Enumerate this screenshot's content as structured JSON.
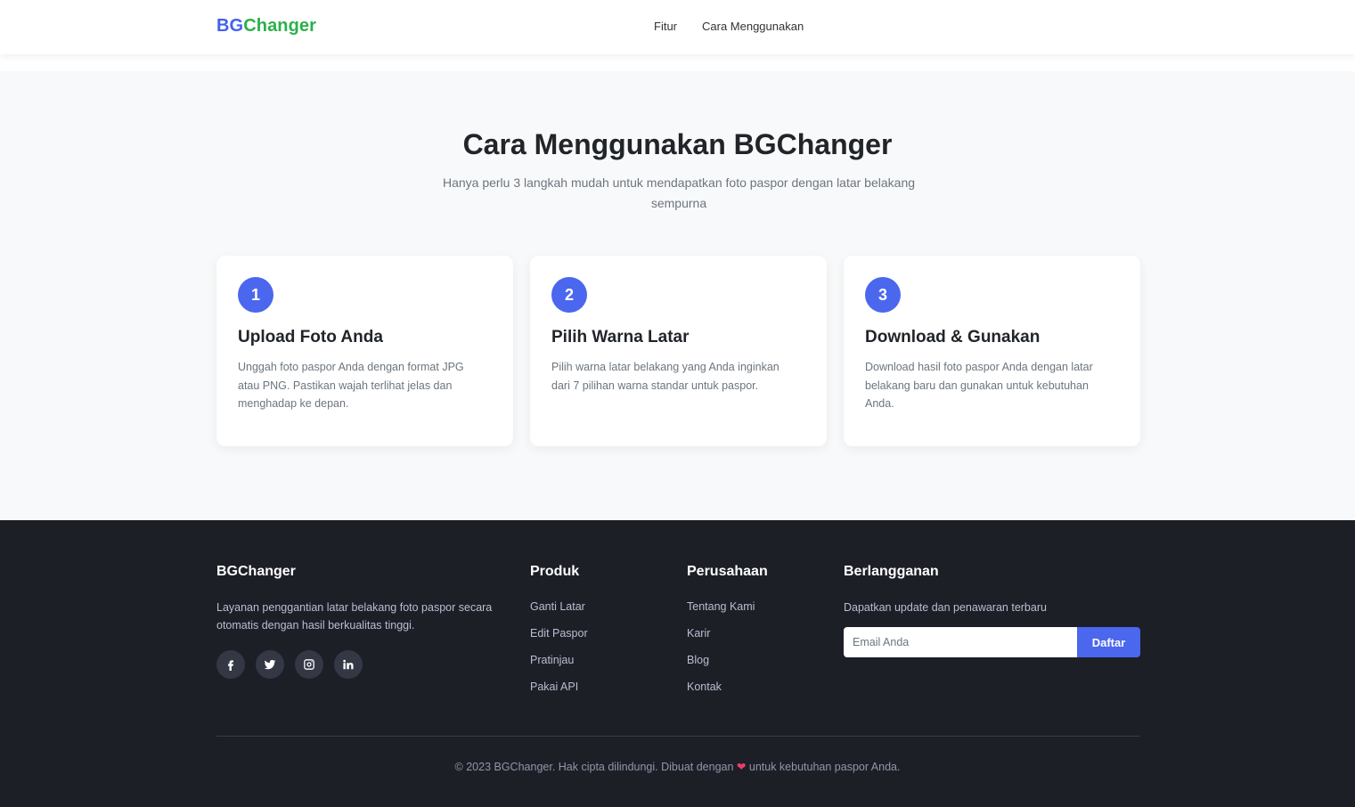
{
  "nav": {
    "logo_part1": "BG",
    "logo_part2": "Changer",
    "links": [
      "Fitur",
      "Cara Menggunakan"
    ]
  },
  "howto": {
    "title": "Cara Menggunakan BGChanger",
    "subtitle": "Hanya perlu 3 langkah mudah untuk mendapatkan foto paspor dengan latar belakang sempurna",
    "steps": [
      {
        "number": "1",
        "title": "Upload Foto Anda",
        "desc": "Unggah foto paspor Anda dengan format JPG atau PNG. Pastikan wajah terlihat jelas dan menghadap ke depan."
      },
      {
        "number": "2",
        "title": "Pilih Warna Latar",
        "desc": "Pilih warna latar belakang yang Anda inginkan dari 7 pilihan warna standar untuk paspor."
      },
      {
        "number": "3",
        "title": "Download & Gunakan",
        "desc": "Download hasil foto paspor Anda dengan latar belakang baru dan gunakan untuk kebutuhan Anda."
      }
    ]
  },
  "footer": {
    "brand": {
      "title": "BGChanger",
      "desc": "Layanan penggantian latar belakang foto paspor secara otomatis dengan hasil berkualitas tinggi.",
      "socials": [
        "facebook-icon",
        "twitter-icon",
        "instagram-icon",
        "linkedin-icon"
      ]
    },
    "produk": {
      "title": "Produk",
      "links": [
        "Ganti Latar",
        "Edit Paspor",
        "Pratinjau",
        "Pakai API"
      ]
    },
    "perusahaan": {
      "title": "Perusahaan",
      "links": [
        "Tentang Kami",
        "Karir",
        "Blog",
        "Kontak"
      ]
    },
    "subscribe": {
      "title": "Berlangganan",
      "desc": "Dapatkan update dan penawaran terbaru",
      "placeholder": "Email Anda",
      "button": "Daftar"
    },
    "copyright_before": "© 2023 BGChanger. Hak cipta dilindungi. Dibuat dengan",
    "heart": "❤",
    "copyright_after": "untuk kebutuhan paspor Anda."
  },
  "colors": {
    "primary": "#4a67ee",
    "logo_green": "#2bb04a",
    "footer_bg": "#1d1f27"
  }
}
